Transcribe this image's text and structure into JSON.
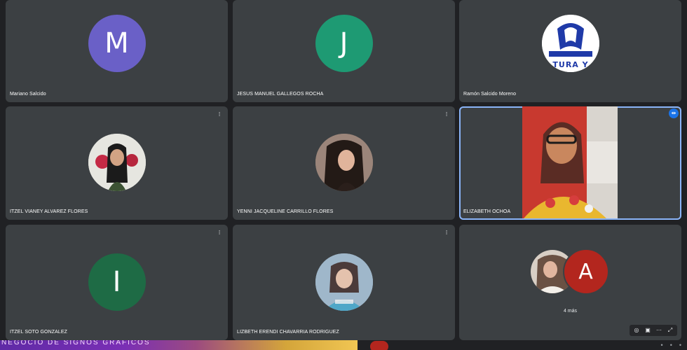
{
  "participants": [
    {
      "name": "Mariano Salcido",
      "initial": "M",
      "color": "#6a60c7"
    },
    {
      "name": "JESUS MANUEL GALLEGOS ROCHA",
      "initial": "J",
      "color": "#1e9a73"
    },
    {
      "name": "Ramón Salcido Moreno",
      "initial": "",
      "logo_text": "TURA Y"
    },
    {
      "name": "ITZEL VIANEY ALVAREZ FLORES"
    },
    {
      "name": "YENNI JACQUELINE CARRILLO FLORES"
    },
    {
      "name": "ELIZABETH OCHOA"
    },
    {
      "name": "ITZEL SOTO GONZALEZ",
      "initial": "I",
      "color": "#1e6b45"
    },
    {
      "name": "LIZBETH ERENDI CHAVARRIA RODRIGUEZ"
    }
  ],
  "more": {
    "letter": "A",
    "count_label": "4 más"
  },
  "icons": {
    "muted": "mic-off-icon",
    "pin": "pin-icon",
    "expand": "expand-icon"
  },
  "bottom": {
    "banner_text": "NEGOCIO DE SIGNOS GRÁFICOS"
  }
}
